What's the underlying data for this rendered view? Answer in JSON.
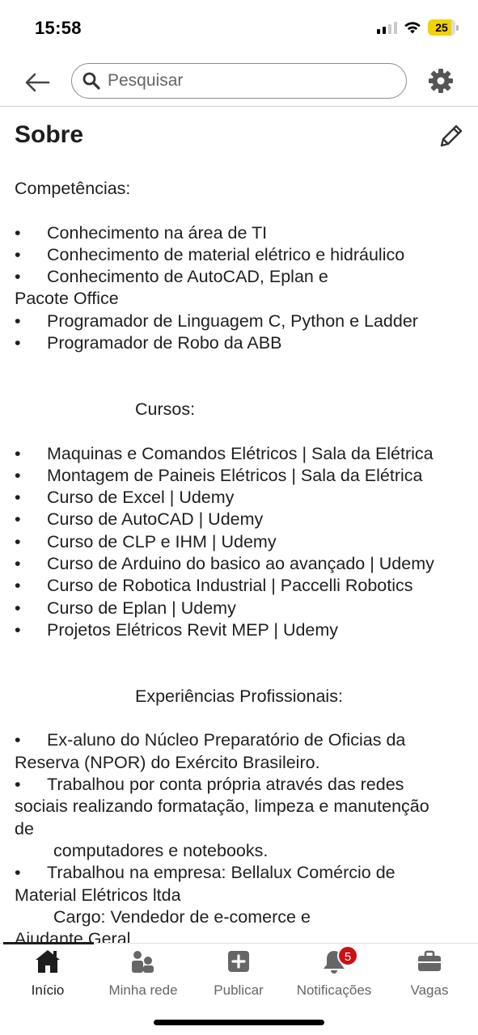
{
  "status": {
    "time": "15:58",
    "battery": "25"
  },
  "header": {
    "search_placeholder": "Pesquisar"
  },
  "section": {
    "title": "Sobre"
  },
  "about_lines": [
    "Competências:",
    "",
    "Conhecimento  na  área de TI",
    "Conhecimento  de  material elétrico e hidráulico",
    "Conhecimento  de  AutoCAD, Eplan e",
    "Pacote Office",
    "Programador de Linguagem C, Python e Ladder",
    "Programador de Robo da ABB",
    "",
    "",
    "Cursos:",
    "",
    "Maquinas e Comandos Elétricos | Sala da Elétrica",
    "Montagem de Paineis Elétricos | Sala da Elétrica",
    "Curso  de Excel  | Udemy",
    "Curso de AutoCAD | Udemy",
    "Curso de CLP e IHM | Udemy",
    "Curso de Arduino do basico ao avançado | Udemy",
    "Curso de Robotica Industrial | Paccelli Robotics",
    "Curso de Eplan | Udemy",
    "Projetos Elétricos Revit MEP | Udemy",
    "",
    "",
    "Experiências Profissionais:",
    "",
    "Ex-aluno do Núcleo Preparatório de Oficias da",
    "Reserva (NPOR) do Exército Brasileiro.",
    "Trabalhou por conta própria através das redes",
    "sociais realizando formatação, limpeza e manutenção",
    "de",
    "computadores e notebooks.",
    "Trabalhou na empresa: Bellalux Comércio de",
    "Material Elétricos ltda",
    "Cargo:  Vendedor de e-comerce e",
    "Ajudante Geral"
  ],
  "bullet_char": "•",
  "nav": {
    "items": [
      {
        "label": "Início",
        "icon": "home-icon"
      },
      {
        "label": "Minha rede",
        "icon": "people-icon"
      },
      {
        "label": "Publicar",
        "icon": "plus-square-icon"
      },
      {
        "label": "Notificações",
        "icon": "bell-icon"
      },
      {
        "label": "Vagas",
        "icon": "briefcase-icon"
      }
    ],
    "notification_count": "5"
  },
  "colors": {
    "text": "#1d1d1d",
    "muted": "#666666",
    "badge": "#cc1016",
    "battery": "#f2d200"
  }
}
